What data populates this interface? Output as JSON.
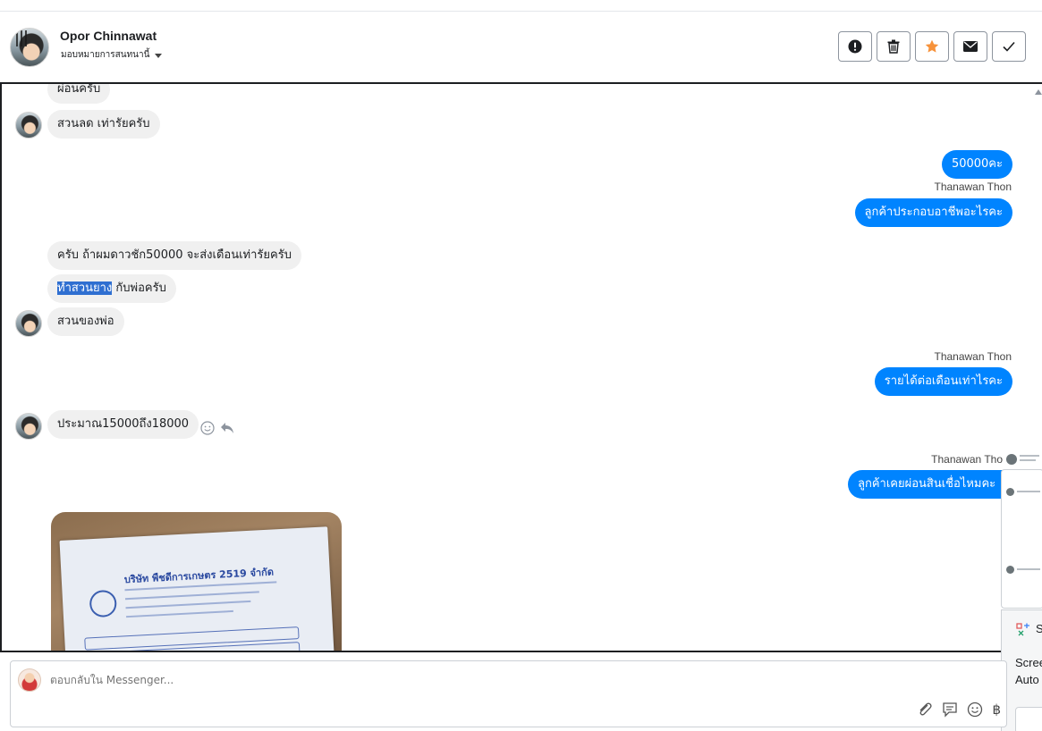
{
  "header": {
    "contact_name": "Opor Chinnawat",
    "assign_label": "มอบหมายการสนทนานี้",
    "actions": [
      {
        "name": "report-button",
        "icon": "exclamation-icon"
      },
      {
        "name": "delete-button",
        "icon": "trash-icon"
      },
      {
        "name": "star-button",
        "icon": "star-icon",
        "color": "#f7923a"
      },
      {
        "name": "mail-button",
        "icon": "envelope-icon"
      },
      {
        "name": "done-button",
        "icon": "check-icon"
      }
    ]
  },
  "messages": {
    "m0": "ผ่อนครับ",
    "m1": "สวนลด เท่ารัยครับ",
    "m2": "50000คะ",
    "s3": "Thanawan Thon",
    "m3": "ลูกค้าประกอบอาชีพอะไรคะ",
    "m4": "ครับ ถ้าผมดาวชัก50000 จะส่งเดือนเท่ารัยครับ",
    "m5_hl": "ทำสวนยาง",
    "m5_rest": " กับพ่อครับ",
    "m6": "สวนของพ่อ",
    "s7": "Thanawan Thon",
    "m7": "รายได้ต่อเดือนเท่าไรคะ",
    "m8": "ประมาณ15000ถึง18000",
    "s9": "Thanawan Tho",
    "m9": "ลูกค้าเคยผ่อนสินเชื่อไหมคะ"
  },
  "receipt": {
    "company": "บริษัท พืชดีการเกษตร 2519 จำกัด"
  },
  "side_panel": {
    "s_label": "S",
    "line1": "Scree",
    "line2": "Auto"
  },
  "composer": {
    "placeholder": "ตอบกลับใน Messenger...",
    "currency": "฿"
  },
  "colors": {
    "outgoing": "#0084ff",
    "incoming": "#f0f0f0",
    "highlight": "#2f6fd1"
  }
}
